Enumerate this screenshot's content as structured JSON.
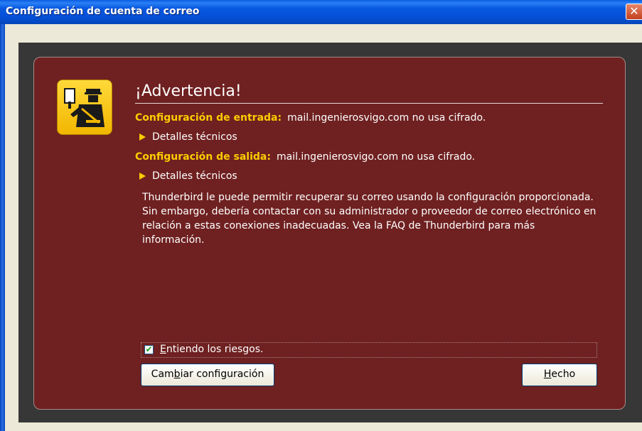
{
  "window": {
    "title": "Configuración de cuenta de correo",
    "close_symbol": "✕"
  },
  "warning": {
    "heading": "¡Advertencia!",
    "incoming_label": "Configuración de entrada:",
    "incoming_value": "mail.ingenierosvigo.com no usa cifrado.",
    "outgoing_label": "Configuración de salida:",
    "outgoing_value": "mail.ingenierosvigo.com no usa cifrado.",
    "details_label": "Detalles técnicos",
    "details_label_2": "Detalles técnicos",
    "message": "Thunderbird le puede permitir recuperar su correo usando la configuración proporcionada. Sin embargo, debería contactar con su administrador o proveedor de correo electrónico en relación a estas conexiones inadecuadas. Vea la FAQ de Thunderbird para más información."
  },
  "checkbox": {
    "checked": true,
    "label_accel": "E",
    "label_rest": "ntiendo los riesgos."
  },
  "buttons": {
    "change_pre": "Cam",
    "change_accel": "b",
    "change_post": "iar configuración",
    "done_accel": "H",
    "done_post": "echo"
  },
  "colors": {
    "panel": "#6f2020",
    "label_accent": "#ffcc00",
    "icon_bg": "#f2b600"
  },
  "icons": {
    "warning": "security-officer-icon",
    "expander": "triangle-right-icon",
    "checkmark": "checkmark-icon"
  }
}
